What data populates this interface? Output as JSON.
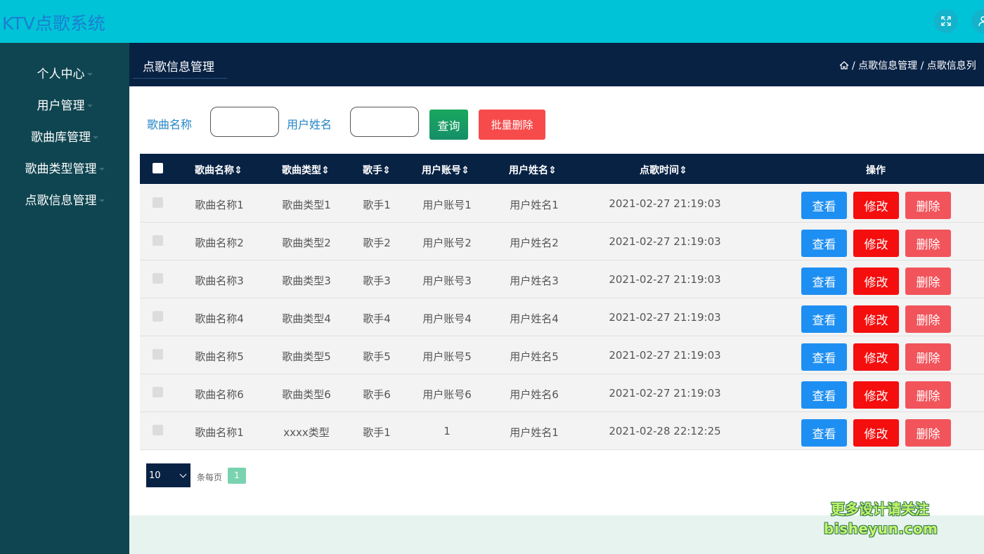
{
  "app": {
    "title": "KTV点歌系统"
  },
  "topbar": {
    "fullscreen_icon": "expand-icon",
    "user_icon": "user-icon"
  },
  "sidebar": {
    "items": [
      {
        "label": "个人中心"
      },
      {
        "label": "用户管理"
      },
      {
        "label": "歌曲库管理"
      },
      {
        "label": "歌曲类型管理"
      },
      {
        "label": "点歌信息管理"
      }
    ]
  },
  "header": {
    "page_title": "点歌信息管理",
    "breadcrumb": "/ 点歌信息管理 / 点歌信息列"
  },
  "search": {
    "song_name_label": "歌曲名称",
    "song_name_value": "",
    "user_name_label": "用户姓名",
    "user_name_value": "",
    "query_label": "查询",
    "batch_delete_label": "批量删除"
  },
  "table": {
    "columns": [
      "歌曲名称⇕",
      "歌曲类型⇕",
      "歌手⇕",
      "用户账号⇕",
      "用户姓名⇕",
      "点歌时间⇕",
      "操作"
    ],
    "rows": [
      [
        "歌曲名称1",
        "歌曲类型1",
        "歌手1",
        "用户账号1",
        "用户姓名1",
        "2021-02-27 21:19:03"
      ],
      [
        "歌曲名称2",
        "歌曲类型2",
        "歌手2",
        "用户账号2",
        "用户姓名2",
        "2021-02-27 21:19:03"
      ],
      [
        "歌曲名称3",
        "歌曲类型3",
        "歌手3",
        "用户账号3",
        "用户姓名3",
        "2021-02-27 21:19:03"
      ],
      [
        "歌曲名称4",
        "歌曲类型4",
        "歌手4",
        "用户账号4",
        "用户姓名4",
        "2021-02-27 21:19:03"
      ],
      [
        "歌曲名称5",
        "歌曲类型5",
        "歌手5",
        "用户账号5",
        "用户姓名5",
        "2021-02-27 21:19:03"
      ],
      [
        "歌曲名称6",
        "歌曲类型6",
        "歌手6",
        "用户账号6",
        "用户姓名6",
        "2021-02-27 21:19:03"
      ],
      [
        "歌曲名称1",
        "xxxx类型",
        "歌手1",
        "1",
        "用户姓名1",
        "2021-02-28 22:12:25"
      ]
    ],
    "action_labels": {
      "view": "查看",
      "edit": "修改",
      "delete": "删除"
    }
  },
  "pagination": {
    "page_size": "10",
    "per_page_label": "条每页",
    "current_page": "1"
  },
  "watermark": {
    "line1": "更多设计请关注",
    "line2": "bisheyun.com"
  },
  "colors": {
    "topbar": "#00c3d8",
    "sidebar": "#0f4550",
    "header": "#082244",
    "query_button": "#19a75e",
    "batch_delete_button": "#f74b4b",
    "view_button": "#1e8ff2",
    "edit_button": "#f50e0e",
    "delete_button": "#f2545b",
    "page_active": "#7ad3b0"
  }
}
